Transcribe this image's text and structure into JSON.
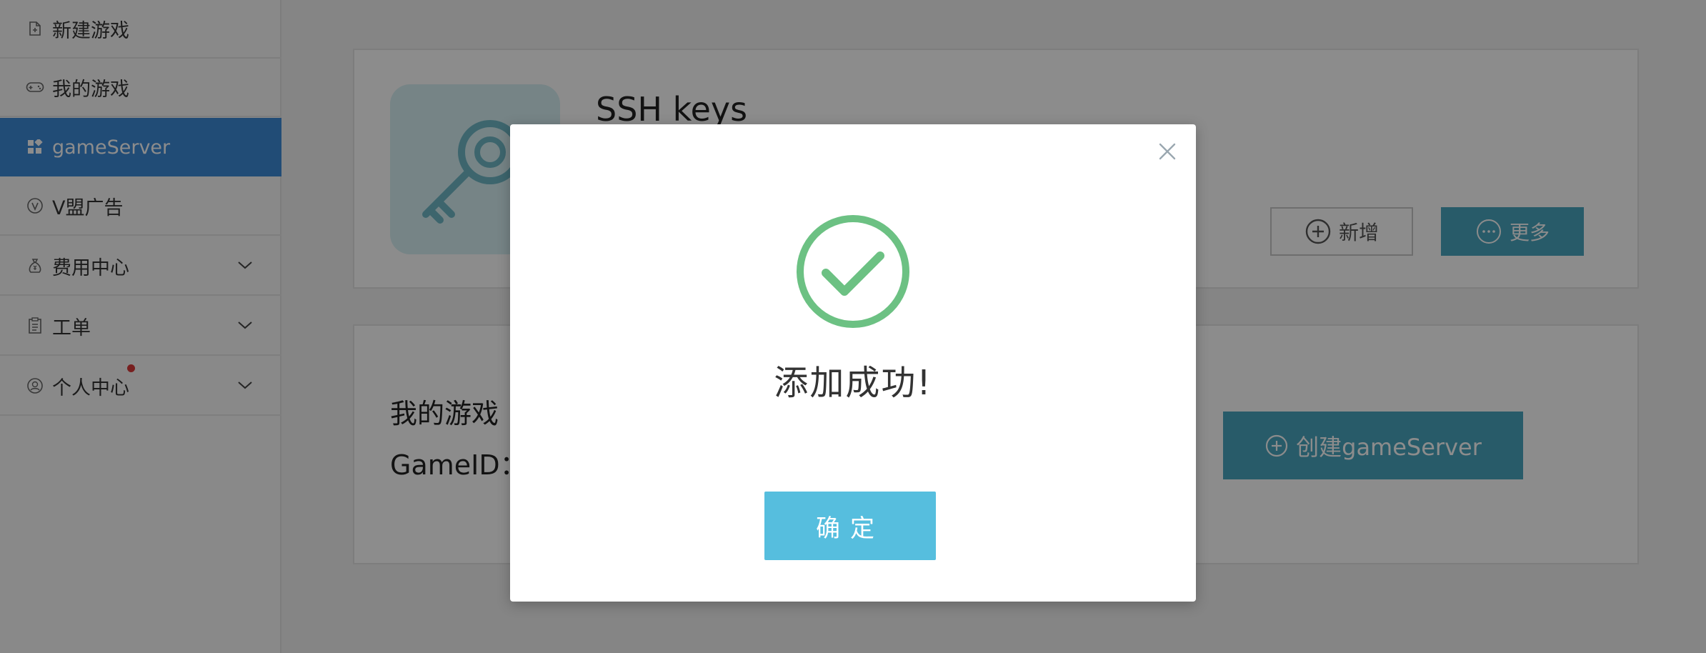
{
  "sidebar": {
    "items": [
      {
        "label": "新建游戏",
        "icon": "new-file-icon"
      },
      {
        "label": "我的游戏",
        "icon": "gamepad-icon"
      },
      {
        "label": "gameServer",
        "icon": "grid-icon",
        "active": true
      },
      {
        "label": "V盟广告",
        "icon": "ad-icon"
      },
      {
        "label": "费用中心",
        "icon": "money-bag-icon",
        "expandable": true
      },
      {
        "label": "工单",
        "icon": "clipboard-icon",
        "expandable": true
      },
      {
        "label": "个人中心",
        "icon": "user-icon",
        "expandable": true,
        "notification_dot": true
      }
    ]
  },
  "ssh_card": {
    "title": "SSH keys",
    "add_label": "新增",
    "more_label": "更多"
  },
  "game_card": {
    "my_game_label": "我的游戏",
    "gameid_label": "GameID：",
    "create_label": "创建gameServer"
  },
  "modal": {
    "message": "添加成功!",
    "ok_label": "确定"
  },
  "colors": {
    "sidebar_active": "#3d8ad8",
    "primary_button": "#4aa6bf",
    "success_green": "#6cc183",
    "ok_button": "#56bede"
  }
}
